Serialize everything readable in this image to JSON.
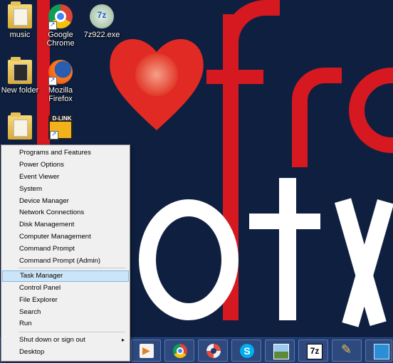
{
  "desktop": {
    "icons": [
      {
        "label": "music",
        "icon": "folder-icon"
      },
      {
        "label": "Google Chrome",
        "icon": "chrome-icon"
      },
      {
        "label": "7z922.exe",
        "icon": "7zip-installer-icon"
      },
      {
        "label": "New folder",
        "icon": "folder-icon"
      },
      {
        "label": "Mozilla Firefox",
        "icon": "firefox-icon"
      },
      {
        "label": "",
        "icon": "folder-icon"
      },
      {
        "label": "",
        "icon": "dlink-icon",
        "logo_text": "D-LINK"
      }
    ]
  },
  "menu": {
    "items": [
      {
        "label": "Programs and Features"
      },
      {
        "label": "Power Options"
      },
      {
        "label": "Event Viewer"
      },
      {
        "label": "System"
      },
      {
        "label": "Device Manager"
      },
      {
        "label": "Network Connections"
      },
      {
        "label": "Disk Management"
      },
      {
        "label": "Computer Management"
      },
      {
        "label": "Command Prompt"
      },
      {
        "label": "Command Prompt (Admin)"
      },
      {
        "label": "Task Manager",
        "selected": true
      },
      {
        "label": "Control Panel"
      },
      {
        "label": "File Explorer"
      },
      {
        "label": "Search"
      },
      {
        "label": "Run"
      },
      {
        "label": "Shut down or sign out",
        "submenu": true
      },
      {
        "label": "Desktop"
      }
    ],
    "submenu_arrow": "▸"
  },
  "taskbar": {
    "apps": [
      "media-player-icon",
      "chrome-icon",
      "help-lifebuoy-icon",
      "skype-icon",
      "image-viewer-icon",
      "7zip-icon",
      "paint-icon",
      "window-icon"
    ]
  },
  "colors": {
    "wallpaper_bg": "#0f1f3f",
    "wallpaper_red": "#d61920",
    "taskbar": "#1c3a73",
    "menu_bg": "#f0f0f0",
    "menu_selected": "#cce4f7"
  }
}
